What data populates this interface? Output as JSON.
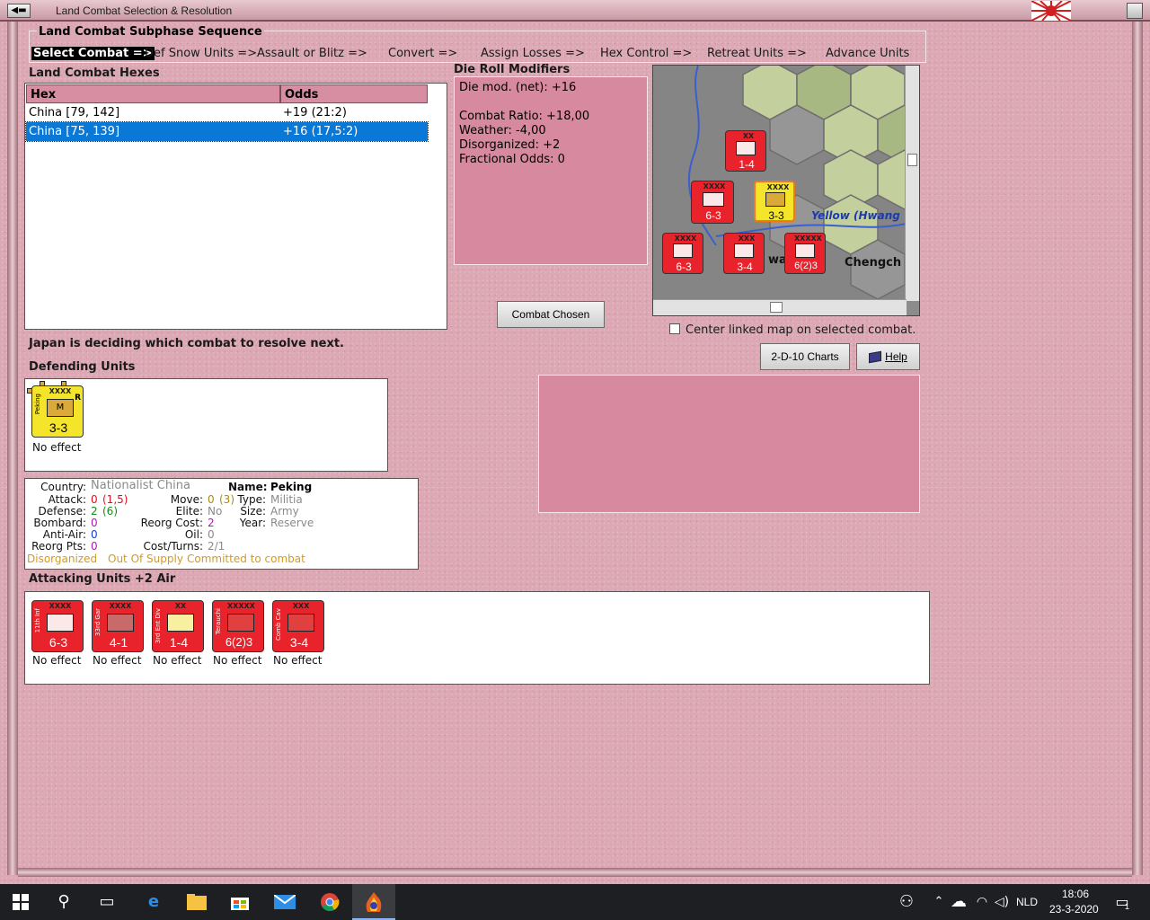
{
  "window": {
    "title": "Land Combat Selection & Resolution"
  },
  "phase": {
    "heading": "Land Combat Subphase Sequence",
    "steps": [
      "Select Combat =>",
      "Def Snow Units =>",
      "Assault or Blitz =>",
      "Convert =>",
      "Assign Losses =>",
      "Hex Control =>",
      "Retreat Units =>",
      "Advance Units"
    ],
    "active_index": 0
  },
  "hexes": {
    "heading": "Land Combat Hexes",
    "columns": [
      "Hex",
      "Odds"
    ],
    "rows": [
      {
        "hex": "China [79, 142]",
        "odds": "+19 (21:2)"
      },
      {
        "hex": "China [75, 139]",
        "odds": "+16 (17,5:2)"
      }
    ],
    "selected_row": 1
  },
  "die_roll": {
    "heading": "Die Roll Modifiers",
    "lines": [
      "Die mod. (net): +16",
      "",
      "Combat Ratio: +18,00",
      "Weather: -4,00",
      "Disorganized: +2",
      "Fractional Odds: 0"
    ]
  },
  "buttons": {
    "combat_chosen": "Combat Chosen",
    "charts": "2-D-10 Charts",
    "help": "Help"
  },
  "map": {
    "labels": [
      "Yellow (Hwang",
      "Chengch",
      "wa"
    ],
    "counters": [
      {
        "name": "11th Inf",
        "size": "XXXX",
        "strength": "6-3"
      },
      {
        "name": "",
        "size": "XX",
        "strength": "1-4"
      },
      {
        "name": "",
        "size": "XXXX",
        "strength": "6-3"
      },
      {
        "name": "",
        "size": "XXX",
        "strength": "3-4"
      },
      {
        "name": "",
        "size": "XXXXX",
        "strength": "6(2)3"
      },
      {
        "name": "Peking",
        "size": "XXXX",
        "strength": "3-3"
      }
    ]
  },
  "center_map_label": "Center linked map on selected combat.",
  "status": "Japan is deciding which combat to resolve next.",
  "defending": {
    "heading": "Defending Units",
    "units": [
      {
        "name": "Peking",
        "size": "XXXX",
        "type_letter": "M",
        "reserve": "R",
        "strength": "3-3",
        "effect": "No effect"
      }
    ]
  },
  "unit_info": {
    "country_label": "Country:",
    "country": "Nationalist China",
    "attack_label": "Attack:",
    "attack": "0",
    "attack_alt": "(1,5)",
    "defense_label": "Defense:",
    "defense": "2",
    "defense_alt": "(6)",
    "bombard_label": "Bombard:",
    "bombard": "0",
    "antiair_label": "Anti-Air:",
    "antiair": "0",
    "reorg_pts_label": "Reorg Pts:",
    "reorg_pts": "0",
    "move_label": "Move:",
    "move": "0",
    "move_alt": "(3)",
    "elite_label": "Elite:",
    "elite": "No",
    "reorg_cost_label": "Reorg Cost:",
    "reorg_cost": "2",
    "oil_label": "Oil:",
    "oil": "0",
    "cost_turns_label": "Cost/Turns:",
    "cost_turns": "2/1",
    "name_label": "Name:",
    "name": "Peking",
    "type_label": "Type:",
    "type": "Militia",
    "size_label": "Size:",
    "size": "Army",
    "year_label": "Year:",
    "year": "Reserve",
    "flag_disorganized": "Disorganized",
    "flag_supply": "Out Of Supply",
    "flag_committed": "Committed to combat"
  },
  "attacking": {
    "heading": "Attacking Units +2 Air",
    "units": [
      {
        "name": "11th Inf",
        "size": "XXXX",
        "strength": "6-3",
        "effect": "No effect"
      },
      {
        "name": "33rd Gar",
        "size": "XXXX",
        "strength": "4-1",
        "effect": "No effect"
      },
      {
        "name": "3rd Ent Div",
        "size": "XX",
        "strength": "1-4",
        "effect": "No effect"
      },
      {
        "name": "Terauchi",
        "size": "XXXXX",
        "strength": "6(2)3",
        "effect": "No effect"
      },
      {
        "name": "Comb Cav",
        "size": "XXX",
        "strength": "3-4",
        "effect": "No effect"
      }
    ]
  },
  "taskbar": {
    "language": "NLD",
    "time": "18:06",
    "date": "23-3-2020",
    "notification_count": "1"
  },
  "colors": {
    "accent_pink": "#d7899f",
    "selected_blue": "#0a78d7",
    "unit_red": "#e8232b",
    "unit_yellow": "#f5e52a"
  }
}
